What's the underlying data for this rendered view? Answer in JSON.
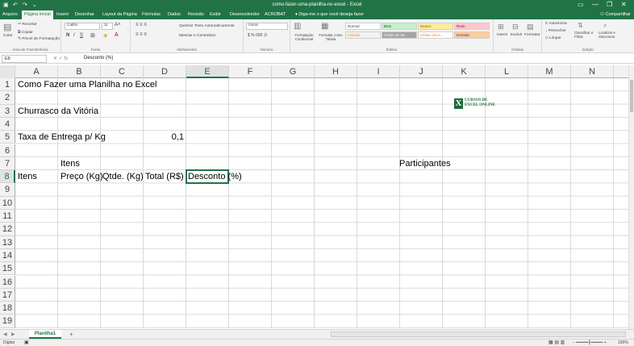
{
  "window": {
    "title": "como-fazer-uma-planilha-no-excel  -  Excel",
    "minimize": "—",
    "restore": "❐",
    "close": "✕"
  },
  "tabs": [
    "Arquivo",
    "Página Inicial",
    "Inserir",
    "Desenhar",
    "Layout da Página",
    "Fórmulas",
    "Dados",
    "Revisão",
    "Exibir",
    "Desenvolvedor",
    "ACROBAT"
  ],
  "tell_me": "Diga-me o que você deseja fazer",
  "share": "Compartilhar",
  "ribbon": {
    "clipboard": {
      "paste": "Colar",
      "cut": "Recortar",
      "copy": "Copiar",
      "painter": "Pincel de Formatação",
      "label": "Área de Transferência"
    },
    "font": {
      "name": "Calibri",
      "size": "11",
      "bold": "N",
      "italic": "I",
      "underline": "S",
      "label": "Fonte"
    },
    "alignment": {
      "wrap": "Quebrar Texto Automaticamente",
      "merge": "Mesclar e Centralizar",
      "label": "Alinhamento"
    },
    "number": {
      "format": "Geral",
      "label": "Número"
    },
    "styles": {
      "conditional": "Formatação Condicional",
      "table": "Formatar como Tabela",
      "normal": "Normal",
      "bom": "Bom",
      "neutro": "Neutro",
      "ruim": "Ruim",
      "calculo": "Cálculo",
      "celula_verif": "Célula de Ve...",
      "celula_vinc": "Célula Vinco...",
      "entrada": "Entrada",
      "label": "Estilos"
    },
    "cells": {
      "insert": "Inserir",
      "delete": "Excluir",
      "format": "Formatar",
      "label": "Células"
    },
    "editing": {
      "autosum": "AutoSoma",
      "fill": "Preencher",
      "clear": "Limpar",
      "sort": "Classificar e Filtrar",
      "find": "Localizar e Selecionar",
      "label": "Edição"
    }
  },
  "formula_bar": {
    "name_box": "E8",
    "content": "Desconto (%)"
  },
  "columns": [
    "A",
    "B",
    "C",
    "D",
    "E",
    "F",
    "G",
    "H",
    "I",
    "J",
    "K",
    "L",
    "M",
    "N"
  ],
  "rows": [
    "1",
    "2",
    "3",
    "4",
    "5",
    "6",
    "7",
    "8",
    "9",
    "10",
    "11",
    "12",
    "13",
    "14",
    "15",
    "16",
    "17",
    "18",
    "19"
  ],
  "cells": {
    "A1": "Como Fazer uma Planilha no Excel",
    "A3": "Churrasco da Vitória",
    "A5": "Taxa de Entrega p/ Kg",
    "D5": "0,1",
    "B7": "Itens",
    "J7": "Participantes",
    "A8": "Itens",
    "B8": "Preço (Kg)",
    "C8": "Qtde. (Kg)",
    "D8": "Total (R$)",
    "E8": "Desconto (%)"
  },
  "logo": {
    "line1": "CURSOS DE",
    "line2": "EXCEL ONLINE",
    "mark": "X"
  },
  "sheet": {
    "name": "Planilha1",
    "add": "+"
  },
  "status": {
    "mode": "Digitar",
    "zoom": "100%"
  },
  "colors": {
    "accent": "#217346"
  }
}
